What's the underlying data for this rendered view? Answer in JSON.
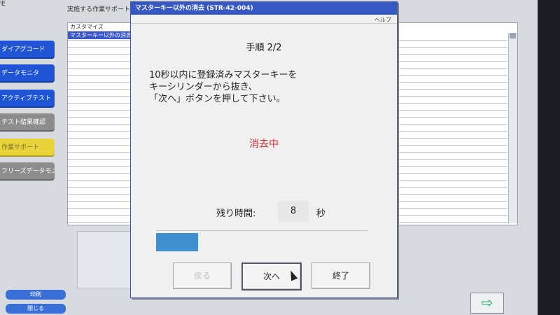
{
  "app": {
    "title": "FE"
  },
  "sidebar": {
    "items": [
      {
        "label": "ダイアグコード",
        "color": "#1f55d4"
      },
      {
        "label": "データモニタ",
        "color": "#1f55d4"
      },
      {
        "label": "アクティブテスト",
        "color": "#1f55d4"
      },
      {
        "label": "テスト結果確認",
        "color": "#8d8d8d"
      },
      {
        "label": "作業サポート",
        "color": "#e8d43a",
        "text_color": "#77702a"
      },
      {
        "label": "フリーズデータモニタ",
        "color": "#8d8d8d"
      }
    ],
    "bottom": [
      {
        "label": "印刷",
        "color": "#3a6fd8"
      },
      {
        "label": "閉じる",
        "color": "#3a6fd8"
      }
    ]
  },
  "main_panel": {
    "label": "実施する作業サポート",
    "list_header": "カスタマイズ",
    "selected_item": "マスターキー以外の消去"
  },
  "dialog": {
    "title": "マスターキー以外の消去 (STR-42-004)",
    "help": "ヘルプ",
    "step": "手順 2/2",
    "instruction": "10秒以内に登録済みマスターキーを\nキーシリンダーから抜き、\n「次へ」ボタンを押して下さい。",
    "status": "消去中",
    "remaining_label": "残り時間:",
    "remaining_value": "8",
    "remaining_unit": "秒",
    "progress": 0.2,
    "buttons": {
      "back": "戻る",
      "next": "次へ",
      "finish": "終了"
    }
  },
  "colors": {
    "titlebar": "#3658c2",
    "status": "#d22b2b",
    "progress": "#3f8fcf"
  }
}
